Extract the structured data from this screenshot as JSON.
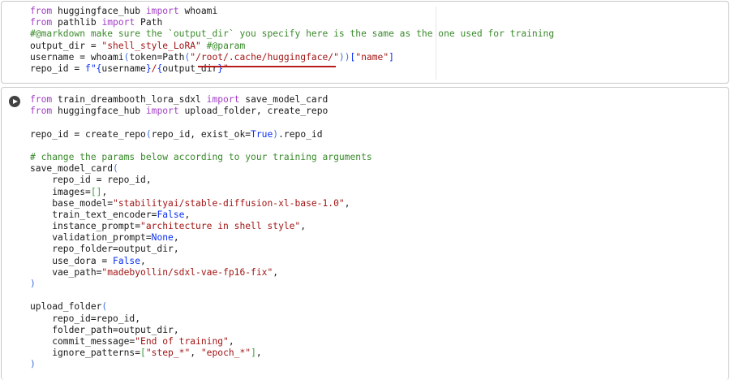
{
  "cells": [
    {
      "lines": [
        [
          [
            "k",
            "from"
          ],
          [
            "n",
            " huggingface_hub "
          ],
          [
            "k",
            "import"
          ],
          [
            "n",
            " whoami"
          ]
        ],
        [
          [
            "k",
            "from"
          ],
          [
            "n",
            " pathlib "
          ],
          [
            "k",
            "import"
          ],
          [
            "n",
            " Path"
          ]
        ],
        [
          [
            "c",
            "#@markdown make sure the `output_dir` you specify here is the same as the one used for training"
          ]
        ],
        [
          [
            "n",
            "output_dir = "
          ],
          [
            "s",
            "\"shell_style_LoRA\""
          ],
          [
            "n",
            " "
          ],
          [
            "c",
            "#@param"
          ]
        ],
        [
          [
            "n",
            "username = whoami"
          ],
          [
            "p",
            "("
          ],
          [
            "n",
            "token=Path"
          ],
          [
            "p",
            "("
          ],
          [
            "s",
            "\"/root/.cache/huggingface/\""
          ],
          [
            "p",
            "))"
          ],
          [
            "b",
            "["
          ],
          [
            "s",
            "\"name\""
          ],
          [
            "b",
            "]"
          ]
        ],
        [
          [
            "n",
            "repo_id = "
          ],
          [
            "b",
            "f\"{"
          ],
          [
            "n",
            "username"
          ],
          [
            "b",
            "}"
          ],
          [
            "s",
            "/"
          ],
          [
            "b",
            "{"
          ],
          [
            "n",
            "output_dir"
          ],
          [
            "b",
            "}"
          ],
          [
            "s",
            "\""
          ]
        ]
      ]
    },
    {
      "lines": [
        [
          [
            "k",
            "from"
          ],
          [
            "n",
            " train_dreambooth_lora_sdxl "
          ],
          [
            "k",
            "import"
          ],
          [
            "n",
            " save_model_card"
          ]
        ],
        [
          [
            "k",
            "from"
          ],
          [
            "n",
            " huggingface_hub "
          ],
          [
            "k",
            "import"
          ],
          [
            "n",
            " upload_folder, create_repo"
          ]
        ],
        [],
        [
          [
            "n",
            "repo_id = create_repo"
          ],
          [
            "p",
            "("
          ],
          [
            "n",
            "repo_id, exist_ok="
          ],
          [
            "b",
            "True"
          ],
          [
            "p",
            ")"
          ],
          [
            "n",
            ".repo_id"
          ]
        ],
        [],
        [
          [
            "c",
            "# change the params below according to your training arguments"
          ]
        ],
        [
          [
            "n",
            "save_model_card"
          ],
          [
            "p",
            "("
          ]
        ],
        [
          [
            "n",
            "    repo_id = repo_id,"
          ]
        ],
        [
          [
            "n",
            "    images="
          ],
          [
            "g",
            "[]"
          ],
          [
            "n",
            ","
          ]
        ],
        [
          [
            "n",
            "    base_model="
          ],
          [
            "s",
            "\"stabilityai/stable-diffusion-xl-base-1.0\""
          ],
          [
            "n",
            ","
          ]
        ],
        [
          [
            "n",
            "    train_text_encoder="
          ],
          [
            "b",
            "False"
          ],
          [
            "n",
            ","
          ]
        ],
        [
          [
            "n",
            "    instance_prompt="
          ],
          [
            "s",
            "\"architecture in shell style\""
          ],
          [
            "n",
            ","
          ]
        ],
        [
          [
            "n",
            "    validation_prompt="
          ],
          [
            "b",
            "None"
          ],
          [
            "n",
            ","
          ]
        ],
        [
          [
            "n",
            "    repo_folder=output_dir,"
          ]
        ],
        [
          [
            "n",
            "    use_dora = "
          ],
          [
            "b",
            "False"
          ],
          [
            "n",
            ","
          ]
        ],
        [
          [
            "n",
            "    vae_path="
          ],
          [
            "s",
            "\"madebyollin/sdxl-vae-fp16-fix\""
          ],
          [
            "n",
            ","
          ]
        ],
        [
          [
            "p",
            ")"
          ]
        ],
        [],
        [
          [
            "n",
            "upload_folder"
          ],
          [
            "p",
            "("
          ]
        ],
        [
          [
            "n",
            "    repo_id=repo_id,"
          ]
        ],
        [
          [
            "n",
            "    folder_path=output_dir,"
          ]
        ],
        [
          [
            "n",
            "    commit_message="
          ],
          [
            "s",
            "\"End of training\""
          ],
          [
            "n",
            ","
          ]
        ],
        [
          [
            "n",
            "    ignore_patterns="
          ],
          [
            "g",
            "["
          ],
          [
            "s",
            "\"step_*\""
          ],
          [
            "n",
            ", "
          ],
          [
            "s",
            "\"epoch_*\""
          ],
          [
            "g",
            "]"
          ],
          [
            "n",
            ","
          ]
        ],
        [
          [
            "p",
            ")"
          ]
        ]
      ]
    }
  ]
}
